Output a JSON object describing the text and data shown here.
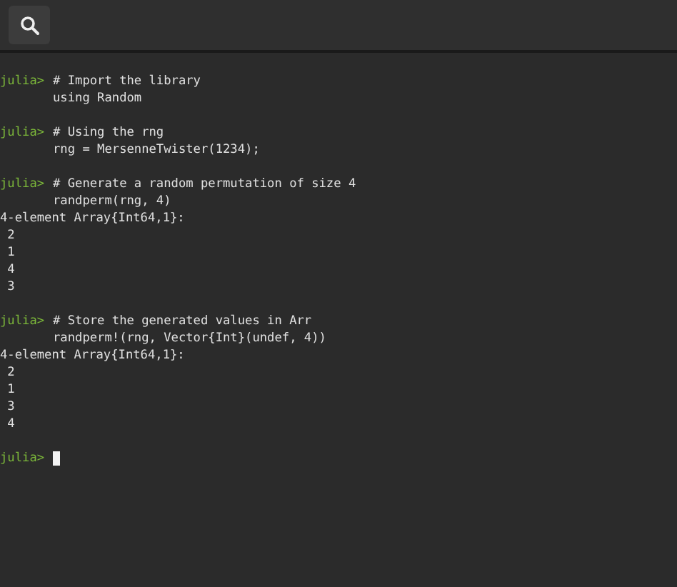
{
  "blocks": [
    {
      "prompt": "julia>",
      "input": [
        "# Import the library",
        "using Random"
      ]
    },
    {
      "prompt": "julia>",
      "input": [
        "# Using the rng",
        "rng = MersenneTwister(1234);"
      ]
    },
    {
      "prompt": "julia>",
      "input": [
        "# Generate a random permutation of size 4",
        "randperm(rng, 4)"
      ],
      "output": [
        "4-element Array{Int64,1}:",
        " 2",
        " 1",
        " 4",
        " 3"
      ]
    },
    {
      "prompt": "julia>",
      "input": [
        "# Store the generated values in Arr",
        "randperm!(rng, Vector{Int}(undef, 4))"
      ],
      "output": [
        "4-element Array{Int64,1}:",
        " 2",
        " 1",
        " 3",
        " 4"
      ]
    }
  ],
  "current_prompt": {
    "prompt": "julia>"
  }
}
